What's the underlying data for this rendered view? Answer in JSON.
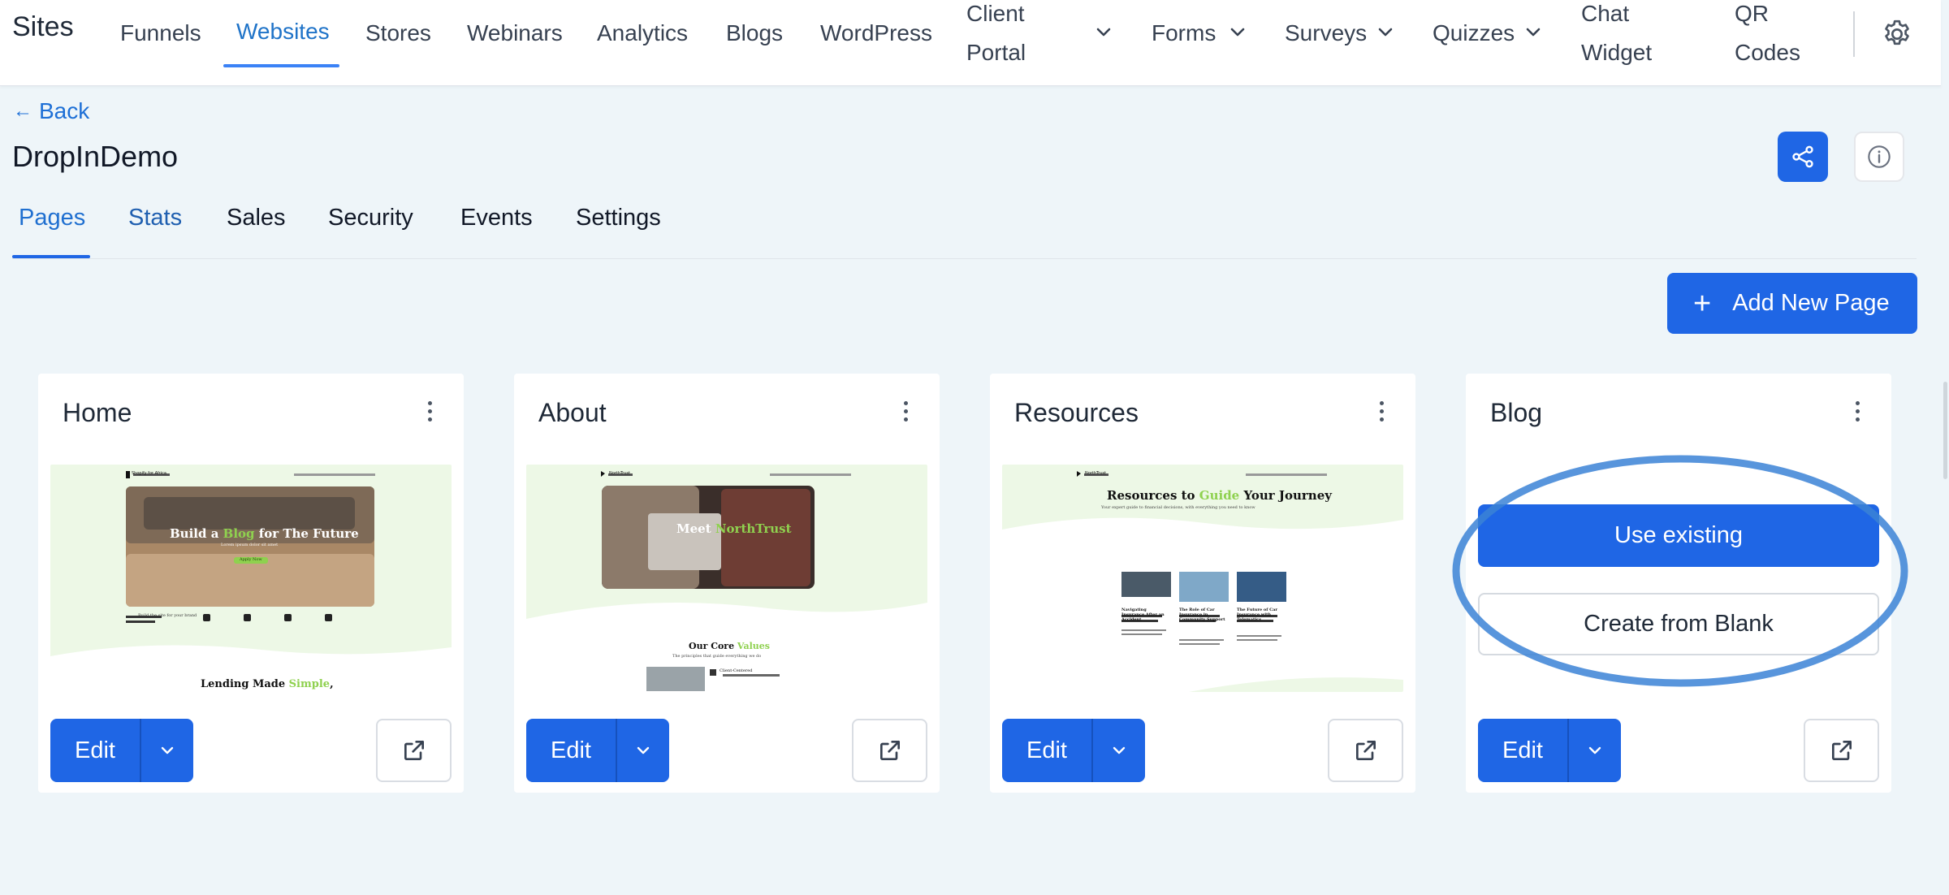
{
  "app": {
    "title": "Sites"
  },
  "nav": {
    "items": [
      "Funnels",
      "Websites",
      "Stores",
      "Webinars",
      "Analytics",
      "Blogs",
      "WordPress"
    ],
    "client_portal": [
      "Client",
      "Portal"
    ],
    "forms": "Forms",
    "surveys": "Surveys",
    "quizzes": "Quizzes",
    "chat_widget": [
      "Chat",
      "Widget"
    ],
    "qr_codes": [
      "QR",
      "Codes"
    ],
    "active": "Websites"
  },
  "header": {
    "back": "Back",
    "title": "DropInDemo"
  },
  "tabs": [
    "Pages",
    "Stats",
    "Sales",
    "Security",
    "Events",
    "Settings"
  ],
  "actions": {
    "add_new_page": "Add New Page"
  },
  "cards": [
    {
      "title": "Home",
      "thumb": {
        "logo": "Shopify for Africa",
        "hero_title_a": "Build a ",
        "hero_title_b": "Blog",
        "hero_title_c": " for The Future",
        "hero_subtitle": "Lorem ipsum dolor sit amet",
        "hero_btn": "Apply Now",
        "intro": "Build the site for your brand",
        "footer_title_a": "Lending Made ",
        "footer_title_b": "Simple",
        "footer_title_c": ","
      },
      "edit": "Edit"
    },
    {
      "title": "About",
      "thumb": {
        "logo": "NorthTrust",
        "hero_title_a": "Meet ",
        "hero_title_b": "NorthTrust",
        "section_title_a": "Our Core ",
        "section_title_b": "Values",
        "section_sub": "The principles that guide everything we do",
        "item_title": "Client-Centered"
      },
      "edit": "Edit"
    },
    {
      "title": "Resources",
      "thumb": {
        "logo": "NorthTrust",
        "hero_title_a": "Resources to ",
        "hero_title_b": "Guide",
        "hero_title_c": " Your Journey",
        "hero_sub": "Your expert guide to financial decisions, with everything you need to know",
        "articles": [
          "Navigating Insurance After an Accident",
          "The Role of Car Insurance in Community Support",
          "The Future of Car Insurance with Telematics"
        ]
      },
      "edit": "Edit"
    },
    {
      "title": "Blog",
      "use_existing": "Use existing",
      "create_blank": "Create from Blank",
      "edit": "Edit"
    }
  ],
  "colors": {
    "primary": "#1f66e5",
    "link": "#1d6fd6",
    "accent_green": "#8fd14f",
    "highlight": "#3b82d6",
    "background": "#eef5f9"
  }
}
